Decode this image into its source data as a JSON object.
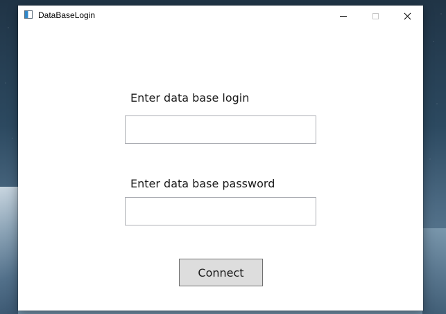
{
  "window": {
    "title": "DataBaseLogin",
    "app_icon": "window-app-icon",
    "controls": {
      "minimize_icon": "minimize-icon",
      "maximize_icon": "maximize-icon",
      "close_icon": "close-icon"
    }
  },
  "form": {
    "login_label": "Enter data base login",
    "login_value": "",
    "password_label": "Enter data base password",
    "password_value": "",
    "connect_label": "Connect"
  },
  "colors": {
    "window_background": "#ffffff",
    "button_background": "#dddddd",
    "button_border": "#707070",
    "input_border": "#abadb3"
  }
}
